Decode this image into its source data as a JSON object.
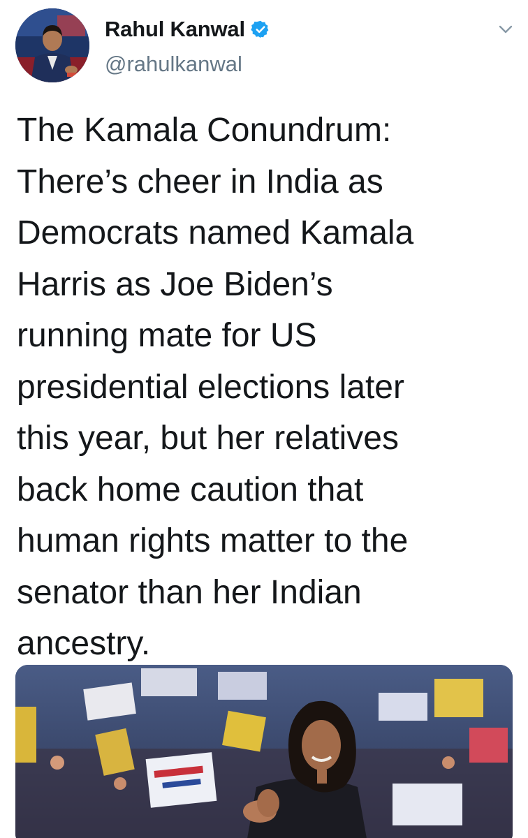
{
  "tweet": {
    "author": {
      "display_name": "Rahul Kanwal",
      "handle": "@rahulkanwal",
      "verified": true,
      "avatar_icon": "profile-photo"
    },
    "menu_icon": "chevron-down-icon",
    "text": "The Kamala Conundrum:\nThere’s cheer in India as\nDemocrats named Kamala\nHarris as Joe Biden’s\nrunning mate for US\npresidential elections later\nthis year, but her relatives\nback home caution that\nhuman rights matter to the\nsenator than her Indian\nancestry.",
    "media": {
      "type": "photo"
    }
  },
  "colors": {
    "text": "#14171a",
    "secondary": "#657786",
    "verified": "#1da1f2",
    "background": "#ffffff"
  }
}
